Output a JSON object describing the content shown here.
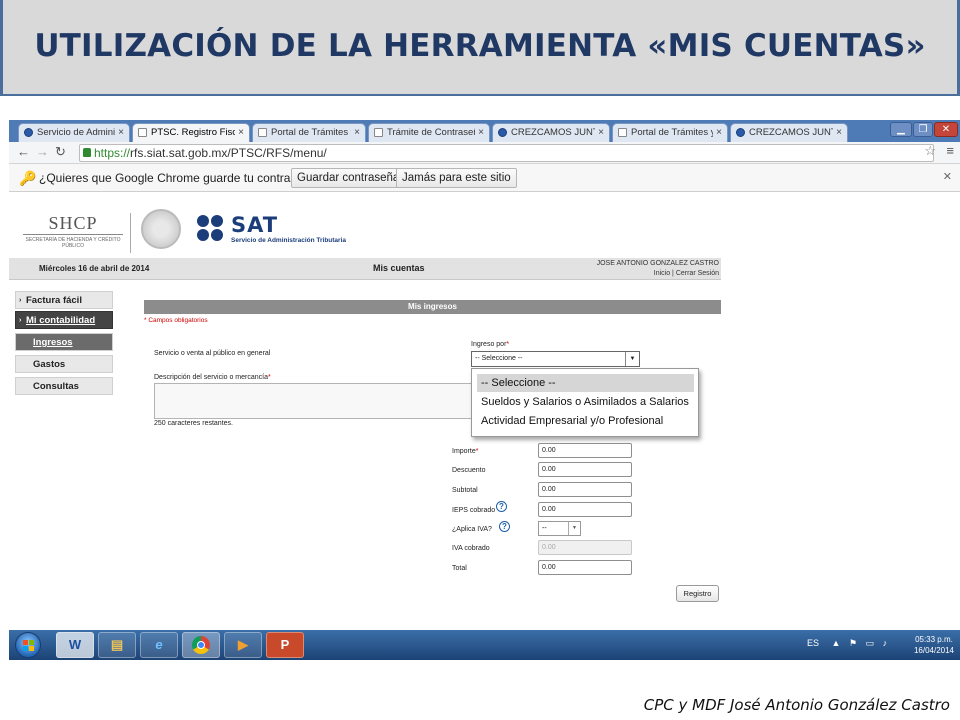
{
  "slide": {
    "title": "UTILIZACIÓN DE LA HERRAMIENTA «MIS CUENTAS»",
    "footer": "CPC y MDF José Antonio González Castro"
  },
  "browser": {
    "tabs": [
      {
        "label": "Servicio de Administra",
        "active": false
      },
      {
        "label": "PTSC. Registro Fiscal S",
        "active": true
      },
      {
        "label": "Portal de Trámites y S",
        "active": false
      },
      {
        "label": "Trámite de Contraseña",
        "active": false
      },
      {
        "label": "CREZCAMOS JUNTOS",
        "active": false
      },
      {
        "label": "Portal de Trámites y Se",
        "active": false
      },
      {
        "label": "CREZCAMOS JUNTOS",
        "active": false
      }
    ],
    "tab_close": "×",
    "url_https": "https://",
    "url_rest": "rfs.siat.sat.gob.mx/PTSC/RFS/menu/",
    "password_prompt": {
      "message": "¿Quieres que Google Chrome guarde tu contraseña?",
      "save_button": "Guardar contraseña",
      "never_button": "Jamás para este sitio"
    }
  },
  "header": {
    "shcp": "SHCP",
    "shcp_sub": "SECRETARÍA DE HACIENDA Y CRÉDITO PÚBLICO",
    "sat": "SAT",
    "sat_sub": "Servicio de Administración Tributaria",
    "date": "Miércoles 16 de abril de 2014",
    "section": "Mis cuentas",
    "user": "JOSE ANTONIO GONZALEZ CASTRO",
    "user_links": "Inicio | Cerrar Sesión"
  },
  "menu": {
    "factura": "Factura fácil",
    "contabilidad": "Mi contabilidad",
    "ingresos": "Ingresos",
    "gastos": "Gastos",
    "consultas": "Consultas"
  },
  "form": {
    "title": "Mis ingresos",
    "required_note": "* Campos obligatorios",
    "servicio_label": "Servicio o venta al público en general",
    "ingreso_label": "Ingreso por",
    "ingreso_value": "-- Seleccione --",
    "descripcion_label": "Descripción del servicio o mercancía",
    "chars_left": "250 caracteres restantes.",
    "dropdown_options": [
      "-- Seleccione --",
      "Sueldos y Salarios o Asimilados a Salarios",
      "Actividad Empresarial y/o Profesional"
    ],
    "importe_label": "Importe",
    "importe_value": "0.00",
    "descuento_label": "Descuento",
    "descuento_value": "0.00",
    "subtotal_label": "Subtotal",
    "subtotal_value": "0.00",
    "ieps_label": "IEPS cobrado",
    "ieps_value": "0.00",
    "iva_q_label": "¿Aplica IVA?",
    "iva_q_value": "--",
    "iva_label": "IVA cobrado",
    "iva_value": "0.00",
    "total_label": "Total",
    "total_value": "0.00",
    "register_button": "Registro",
    "asterisk": "*",
    "help": "?"
  },
  "taskbar": {
    "lang": "ES",
    "time": "05:33 p.m.",
    "date": "16/04/2014"
  }
}
